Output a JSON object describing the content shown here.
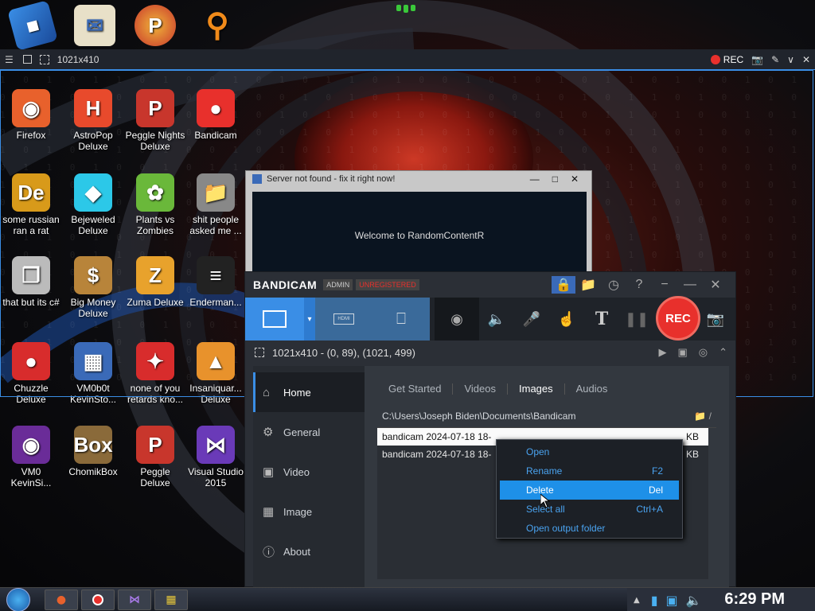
{
  "colors": {
    "accent": "#3a8ee6",
    "rec_red": "#e8302c",
    "menu_text": "#4aa3f0",
    "menu_hover": "#1e90e8"
  },
  "top_icons": [
    {
      "icon": "blue-book-icon"
    },
    {
      "icon": "windows-update-icon"
    },
    {
      "icon": "peggle-icon"
    },
    {
      "icon": "search-magnifier-icon"
    }
  ],
  "region_bar": {
    "size_label": "1021x410",
    "rec_label": "REC"
  },
  "desktop": [
    {
      "label": "Firefox",
      "icon": "firefox-icon",
      "color": "#e8612c"
    },
    {
      "label": "AstroPop Deluxe",
      "icon": "astropop-icon",
      "color": "#e84a2c"
    },
    {
      "label": "Peggle Nights Deluxe",
      "icon": "peggle-icon",
      "color": "#c8362c"
    },
    {
      "label": "Bandicam",
      "icon": "bandicam-icon",
      "color": "#e8302c"
    },
    {
      "label": "some russian ran a rat",
      "icon": "de-icon",
      "color": "#d89a1a"
    },
    {
      "label": "Bejeweled Deluxe",
      "icon": "diamond-icon",
      "color": "#2cc8e8"
    },
    {
      "label": "Plants vs Zombies",
      "icon": "plants-icon",
      "color": "#6ab83a"
    },
    {
      "label": "shit people asked me ...",
      "icon": "folder-icon",
      "color": "#888888"
    },
    {
      "label": "that but its c#",
      "icon": "copy-icon",
      "color": "#bbbbbb"
    },
    {
      "label": "Big Money Deluxe",
      "icon": "money-bag-icon",
      "color": "#b8843a"
    },
    {
      "label": "Zuma Deluxe",
      "icon": "zuma-icon",
      "color": "#e8a22c"
    },
    {
      "label": "Enderman...",
      "icon": "console-icon",
      "color": "#222222"
    },
    {
      "label": "Chuzzle Deluxe",
      "icon": "chuzzle-icon",
      "color": "#d82c2c"
    },
    {
      "label": "VM0b0t KevinSto...",
      "icon": "vm-icon",
      "color": "#3a6ab8"
    },
    {
      "label": "none of you retards kno...",
      "icon": "dragon-icon",
      "color": "#d82c2c"
    },
    {
      "label": "Insaniquar... Deluxe",
      "icon": "fish-icon",
      "color": "#e8922c"
    },
    {
      "label": "VM0 KevinSi...",
      "icon": "firefox-dark-icon",
      "color": "#6a2c98"
    },
    {
      "label": "ChomikBox",
      "icon": "chomik-icon",
      "color": "#8a6a3a"
    },
    {
      "label": "Peggle Deluxe",
      "icon": "peggle-icon",
      "color": "#c8362c"
    },
    {
      "label": "Visual Studio 2015",
      "icon": "visual-studio-icon",
      "color": "#6a3ab8"
    }
  ],
  "server_window": {
    "title": "Server not found - fix it right now!",
    "body": "Welcome to RandomContentR"
  },
  "bandicam": {
    "brand": "BANDICAM",
    "badge_admin": "ADMIN",
    "badge_unreg": "UNREGISTERED",
    "rec_label": "REC",
    "status": "1021x410 - (0, 89), (1021, 499)",
    "sidebar": [
      {
        "label": "Home",
        "icon": "home-icon",
        "active": true
      },
      {
        "label": "General",
        "icon": "gear-icon",
        "active": false
      },
      {
        "label": "Video",
        "icon": "film-icon",
        "active": false
      },
      {
        "label": "Image",
        "icon": "image-icon",
        "active": false
      },
      {
        "label": "About",
        "icon": "info-icon",
        "active": false
      }
    ],
    "tabs": [
      "Get Started",
      "Videos",
      "Images",
      "Audios"
    ],
    "active_tab": "Images",
    "path": "C:\\Users\\Joseph Biden\\Documents\\Bandicam",
    "files": [
      {
        "name": "bandicam 2024-07-18 18-",
        "size": "KB",
        "selected": true
      },
      {
        "name": "bandicam 2024-07-18 18-",
        "size": "KB",
        "selected": false
      }
    ]
  },
  "context_menu": [
    {
      "label": "Open",
      "shortcut": ""
    },
    {
      "label": "Rename",
      "shortcut": "F2"
    },
    {
      "label": "Delete",
      "shortcut": "Del",
      "hover": true
    },
    {
      "label": "Select all",
      "shortcut": "Ctrl+A"
    },
    {
      "label": "Open output folder",
      "shortcut": ""
    }
  ],
  "taskbar": {
    "clock": "6:29 PM"
  }
}
